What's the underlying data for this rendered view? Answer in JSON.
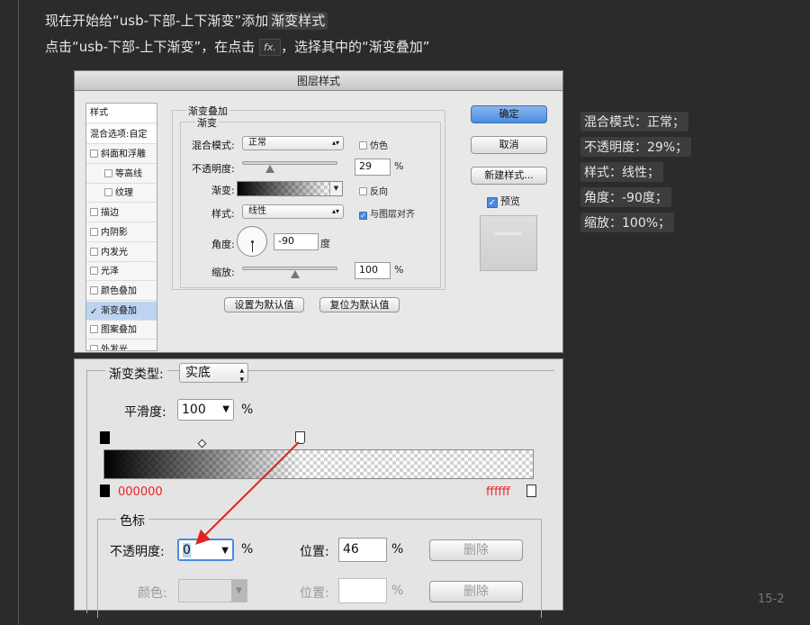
{
  "instructions": {
    "line1_a": "现在开始给“usb-下部-上下渐变”添加",
    "line1_b": "渐变样式",
    "line2_a": "点击“usb-下部-上下渐变”，在点击",
    "line2_fx": "fx.",
    "line2_b": "，选择其中的“渐变叠加”"
  },
  "notes": [
    "混合模式：正常；",
    "不透明度：29%；",
    "样式：线性；",
    "角度：-90度；",
    "缩放：100%；"
  ],
  "page_number": "15-2",
  "dialog": {
    "title": "图层样式",
    "sidebar": {
      "header": "样式",
      "blend_options": "混合选项:自定",
      "items": [
        "斜面和浮雕",
        "等高线",
        "纹理",
        "描边",
        "内阴影",
        "内发光",
        "光泽",
        "颜色叠加",
        "渐变叠加",
        "图案叠加",
        "外发光"
      ],
      "active_index": 8
    },
    "section_title": "渐变叠加",
    "group_title": "渐变",
    "blend_label": "混合模式:",
    "blend_value": "正常",
    "dither_label": "仿色",
    "opacity_label": "不透明度:",
    "opacity_value": "29",
    "opacity_unit": "%",
    "opacity_level": 0.29,
    "gradient_label": "渐变:",
    "reverse_label": "反向",
    "style_label": "样式:",
    "style_value": "线性",
    "align_label": "与图层对齐",
    "angle_label": "角度:",
    "angle_value": "-90",
    "angle_unit": "度",
    "scale_label": "缩放:",
    "scale_value": "100",
    "scale_unit": "%",
    "scale_level": 0.5,
    "set_default": "设置为默认值",
    "reset_default": "复位为默认值",
    "ok": "确定",
    "cancel": "取消",
    "new_style": "新建样式...",
    "preview": "预览"
  },
  "editor": {
    "type_label": "渐变类型:",
    "type_value": "实底",
    "smooth_label": "平滑度:",
    "smooth_value": "100",
    "smooth_unit": "%",
    "left_color": "000000",
    "right_color": "ffffff",
    "color_stop_title": "色标",
    "opacity_label": "不透明度:",
    "opacity_value": "0",
    "opacity_unit": "%",
    "location_label": "位置:",
    "location_value": "46",
    "location_unit": "%",
    "delete_label": "删除",
    "color_label": "颜色:",
    "location2_label": "位置:",
    "location2_unit": "%",
    "delete2_label": "删除",
    "colors": {
      "annotation": "#e22222",
      "highlight": "#2a6fd8"
    }
  }
}
